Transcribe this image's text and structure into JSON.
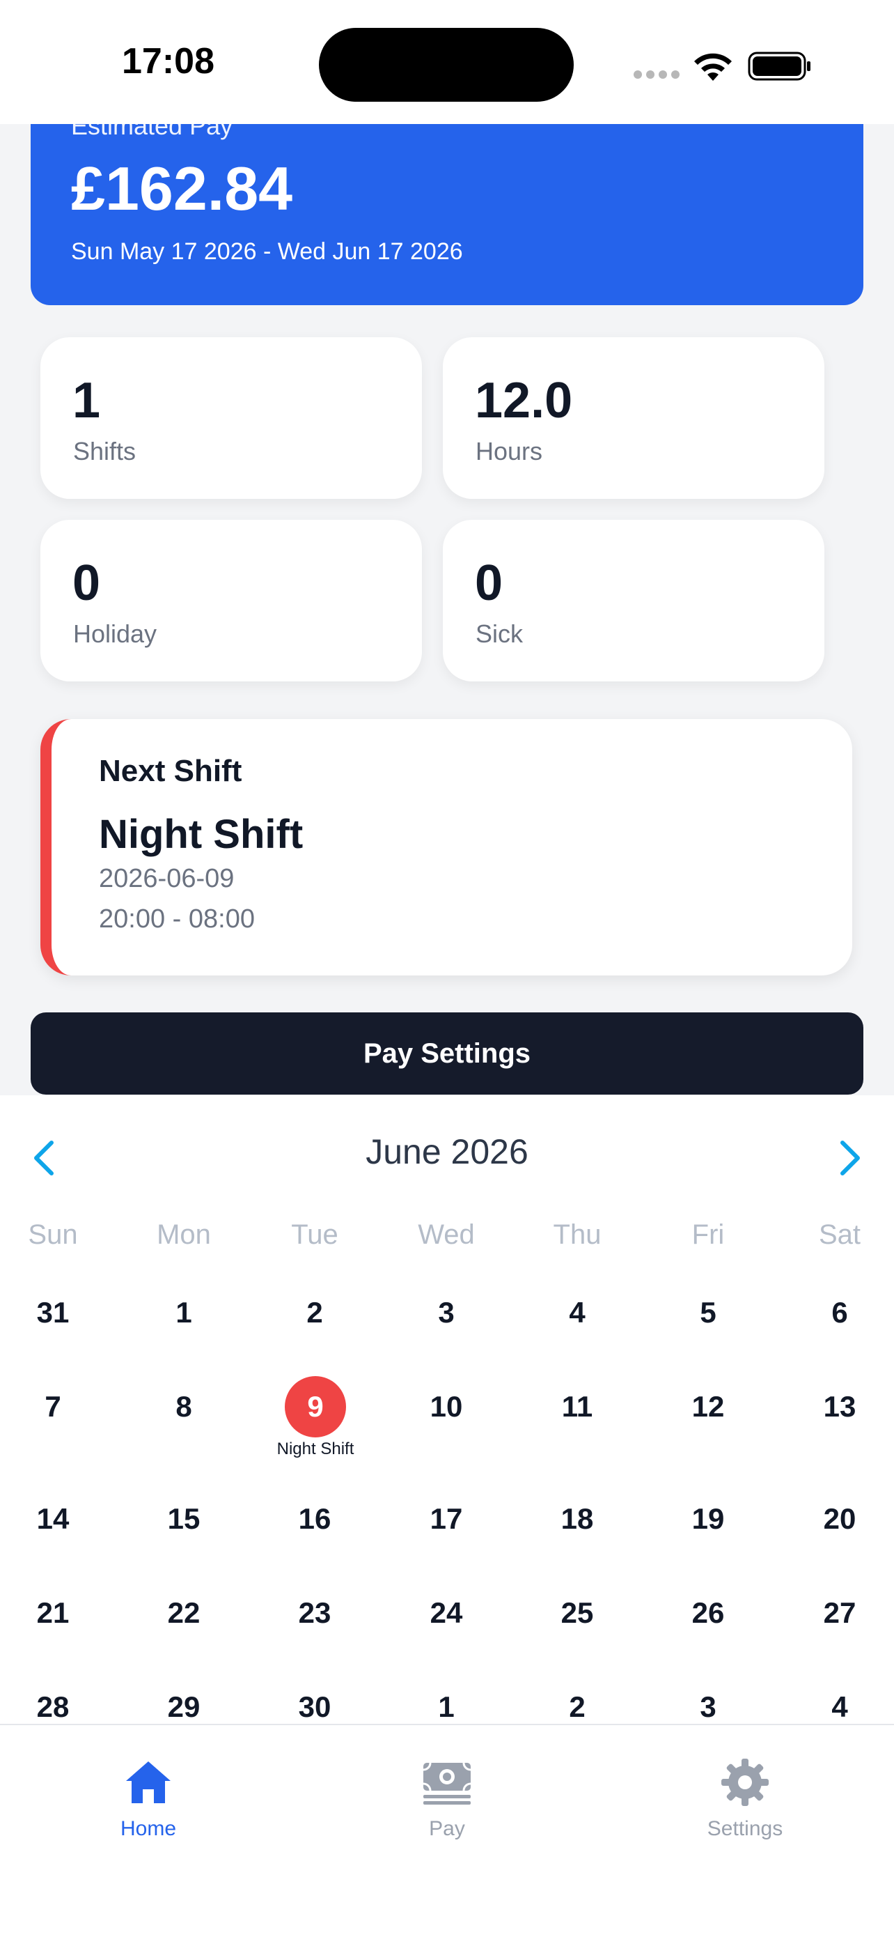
{
  "status_bar": {
    "time": "17:08"
  },
  "pay_card": {
    "label": "Estimated Pay",
    "amount": "£162.84",
    "range": "Sun May 17 2026 - Wed Jun 17 2026"
  },
  "stats": [
    {
      "value": "1",
      "label": "Shifts"
    },
    {
      "value": "12.0",
      "label": "Hours"
    },
    {
      "value": "0",
      "label": "Holiday"
    },
    {
      "value": "0",
      "label": "Sick"
    }
  ],
  "next_shift": {
    "heading": "Next Shift",
    "name": "Night Shift",
    "date": "2026-06-09",
    "time": "20:00 - 08:00",
    "accent_color": "#ef4444"
  },
  "pay_settings_button": {
    "label": "Pay Settings"
  },
  "calendar": {
    "month": "June 2026",
    "prev_icon": "chevron-left-icon",
    "next_icon": "chevron-right-icon",
    "weekdays": [
      "Sun",
      "Mon",
      "Tue",
      "Wed",
      "Thu",
      "Fri",
      "Sat"
    ],
    "weeks": [
      [
        "31",
        "1",
        "2",
        "3",
        "4",
        "5",
        "6"
      ],
      [
        "7",
        "8",
        "9",
        "10",
        "11",
        "12",
        "13"
      ],
      [
        "14",
        "15",
        "16",
        "17",
        "18",
        "19",
        "20"
      ],
      [
        "21",
        "22",
        "23",
        "24",
        "25",
        "26",
        "27"
      ],
      [
        "28",
        "29",
        "30",
        "1",
        "2",
        "3",
        "4"
      ]
    ],
    "highlighted_day": "9",
    "highlighted_event": "Night Shift"
  },
  "tab_bar": {
    "items": [
      {
        "label": "Home",
        "icon": "home-icon",
        "active": true
      },
      {
        "label": "Pay",
        "icon": "banknote-icon",
        "active": false
      },
      {
        "label": "Settings",
        "icon": "gear-icon",
        "active": false
      }
    ],
    "active_color": "#2563eb",
    "inactive_color": "#9aa1ad"
  }
}
